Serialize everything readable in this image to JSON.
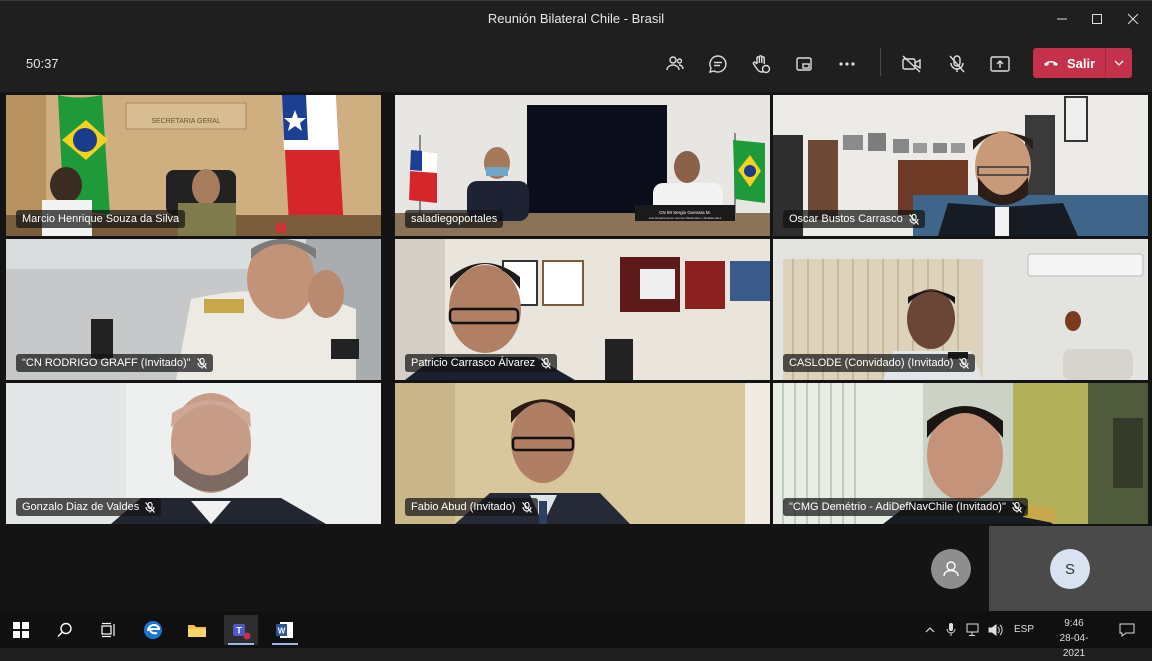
{
  "window": {
    "title": "Reunión Bilateral Chile - Brasil"
  },
  "toolbar": {
    "timer": "50:37",
    "icons": [
      "people-icon",
      "chat-icon",
      "raise-hand-icon",
      "share-tray-icon",
      "more-icon",
      "camera-off-icon",
      "mic-off-icon",
      "share-icon"
    ],
    "leave_label": "Salir",
    "leave_color": "#c4314b"
  },
  "participants": [
    {
      "name": "Marcio Henrique Souza da Silva",
      "muted": false
    },
    {
      "name": "saladiegoportales",
      "muted": false
    },
    {
      "name": "Oscar Bustos Carrasco",
      "muted": true
    },
    {
      "name": "\"CN RODRIGO GRAFF (Invitado)\"",
      "muted": true
    },
    {
      "name": "Patricio Carrasco Álvarez",
      "muted": true
    },
    {
      "name": "CASLODE (Convidado) (Invitado)",
      "muted": true
    },
    {
      "name": "Gonzalo Diaz de Valdes",
      "muted": true
    },
    {
      "name": "Fabio Abud (Invitado)",
      "muted": true
    },
    {
      "name": "\"CMG Demétrio - AdiDefNavChile (Invitado)\"",
      "muted": true
    }
  ],
  "video_labels": {
    "wall_sign": "SECRETARIA GERAL",
    "name_plate": "CN IM Sergio Guevara M.",
    "name_plate_sub": "Jefe Departamento Asuntos Bilaterales y Multilaterales"
  },
  "self_avatar": {
    "initial": "S"
  },
  "taskbar": {
    "language": "ESP",
    "time": "9:46",
    "date": "28-04-2021"
  }
}
